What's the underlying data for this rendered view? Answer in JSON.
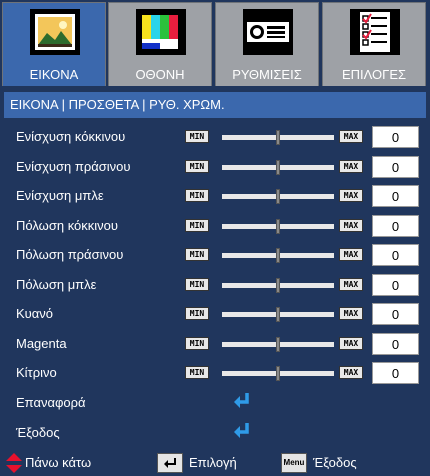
{
  "tabs": [
    {
      "label": "ΕΙΚΟΝΑ",
      "icon": "picture-icon",
      "active": true
    },
    {
      "label": "ΟΘΟΝΗ",
      "icon": "display-icon",
      "active": false
    },
    {
      "label": "ΡΥΘΜΙΣΕΙΣ",
      "icon": "projector-icon",
      "active": false
    },
    {
      "label": "ΕΠΙΛΟΓΕΣ",
      "icon": "checklist-icon",
      "active": false
    }
  ],
  "breadcrumb": "ΕΙΚΟΝΑ | ΠΡΟΣΘΕΤΑ | ΡΥΘ. ΧΡΩΜ.",
  "slider_tags": {
    "min": "MIN",
    "max": "MAX"
  },
  "sliders": [
    {
      "label": "Ενίσχυση κόκκινου",
      "value": "0",
      "level": 0.5
    },
    {
      "label": "Ενίσχυση πράσινου",
      "value": "0",
      "level": 0.5
    },
    {
      "label": "Ενίσχυση μπλε",
      "value": "0",
      "level": 0.5
    },
    {
      "label": "Πόλωση κόκκινου",
      "value": "0",
      "level": 0.5
    },
    {
      "label": "Πόλωση πράσινου",
      "value": "0",
      "level": 0.5
    },
    {
      "label": "Πόλωση μπλε",
      "value": "0",
      "level": 0.5
    },
    {
      "label": "Κυανό",
      "value": "0",
      "level": 0.5
    },
    {
      "label": "Magenta",
      "value": "0",
      "level": 0.5
    },
    {
      "label": "Κίτρινο",
      "value": "0",
      "level": 0.5
    }
  ],
  "actions": [
    {
      "label": "Επαναφορά",
      "icon": "enter-arrow-icon"
    },
    {
      "label": "Έξοδος",
      "icon": "enter-arrow-icon"
    }
  ],
  "footer": {
    "updown": "Πάνω κάτω",
    "select": "Επιλογή",
    "menu_key": "Menu",
    "exit": "Έξοδος"
  },
  "colors": {
    "background": "#20365d",
    "active_tab": "#3b68ad",
    "inactive_tab": "#9ea1a6",
    "enter_icon": "#2f9be8",
    "updown_icon": "#e8112d"
  }
}
